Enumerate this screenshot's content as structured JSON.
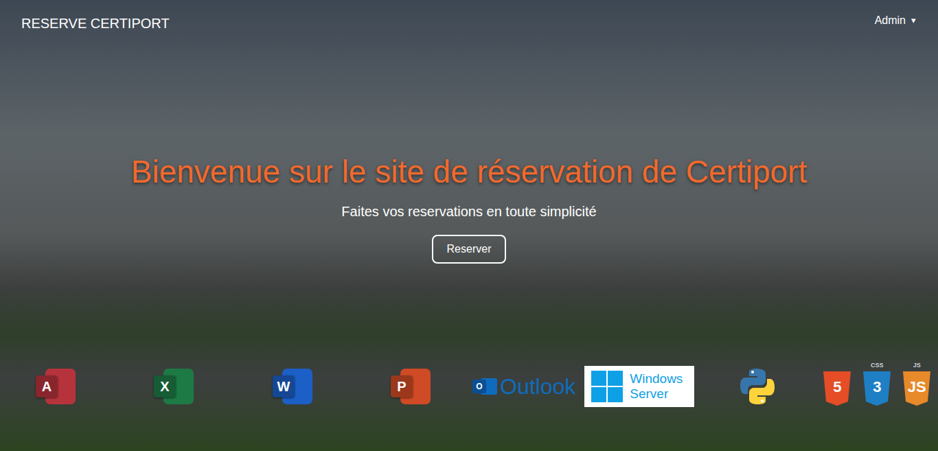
{
  "nav": {
    "brand": "RESERVE CERTIPORT",
    "user": "Admin",
    "caret": "▾"
  },
  "hero": {
    "title": "Bienvenue sur le site de réservation de Certiport",
    "subtitle": "Faites vos reservations en toute simplicité",
    "button": "Reserver"
  },
  "logos": [
    {
      "kind": "office",
      "mark": "A",
      "color": "#b7333c"
    },
    {
      "kind": "office",
      "mark": "X",
      "color": "#1d7a45"
    },
    {
      "kind": "office",
      "mark": "W",
      "color": "#1c5fc7"
    },
    {
      "kind": "office",
      "mark": "P",
      "color": "#cf4a25"
    },
    {
      "kind": "outlook",
      "mark": "O",
      "label": "Outlook",
      "color": "#0f6cbd"
    },
    {
      "kind": "windows",
      "lines": [
        "Windows",
        "Server"
      ],
      "color": "#0ea0e6"
    },
    {
      "kind": "python"
    },
    {
      "kind": "shield",
      "mark": "5",
      "color": "#e44d26"
    },
    {
      "kind": "shield",
      "mark": "3",
      "caption": "CSS",
      "color": "#1f7fc4"
    },
    {
      "kind": "shield",
      "mark": "JS",
      "caption": "JS",
      "color": "#e8892a"
    }
  ]
}
